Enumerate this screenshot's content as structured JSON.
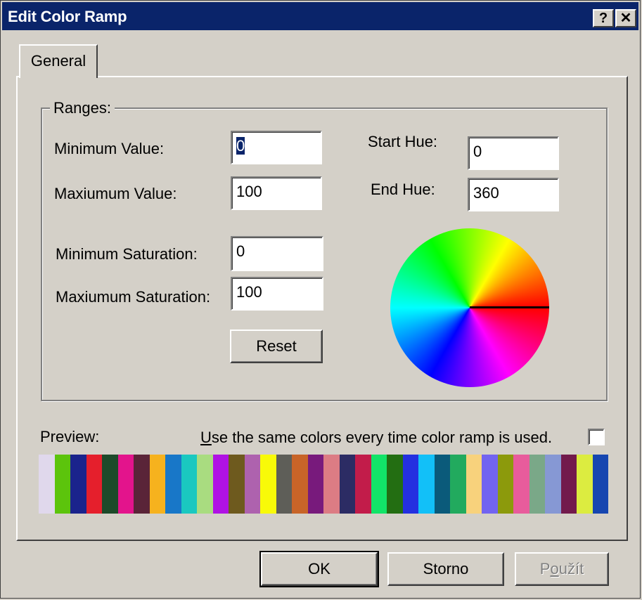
{
  "window": {
    "title": "Edit Color Ramp",
    "help_glyph": "?",
    "close_glyph": "✕"
  },
  "tabs": [
    {
      "label": "General",
      "selected": true
    }
  ],
  "ranges": {
    "legend": "Ranges:",
    "min_value_label": "Minimum Value:",
    "min_value": "0",
    "max_value_label": "Maxiumum Value:",
    "max_value": "100",
    "min_saturation_label": "Minimum Saturation:",
    "min_saturation": "0",
    "max_saturation_label": "Maxiumum Saturation:",
    "max_saturation": "100",
    "start_hue_label": "Start Hue:",
    "start_hue": "0",
    "end_hue_label": "End Hue:",
    "end_hue": "360",
    "reset_label": "Reset"
  },
  "preview": {
    "label": "Preview:",
    "same_colors_prefix": "U",
    "same_colors_rest": "se the same colors every time color ramp is used.",
    "same_colors_checked": false,
    "swatches": [
      "#e0d8ec",
      "#5cc40c",
      "#1a238c",
      "#e51f2c",
      "#1d4a2a",
      "#e3148c",
      "#5a2438",
      "#f6b21e",
      "#1877c8",
      "#1ac8c0",
      "#a9dc80",
      "#b012e4",
      "#6e5a1e",
      "#ae62ae",
      "#f8fa08",
      "#5e5e58",
      "#c86428",
      "#781a7c",
      "#dc7c84",
      "#2c2c64",
      "#c21c4a",
      "#12e468",
      "#236e12",
      "#2430e0",
      "#12c0f8",
      "#0a5a7a",
      "#22aa5e",
      "#f8d27c",
      "#7264f0",
      "#8c9a0c",
      "#e85c9c",
      "#7aa888",
      "#8698d4",
      "#721a4c",
      "#dcec40",
      "#1646b0"
    ]
  },
  "footer": {
    "ok_label": "OK",
    "cancel_label": "Storno",
    "apply_prefix": "P",
    "apply_mnemonic": "o",
    "apply_rest": "užít"
  },
  "colors": {
    "titlebar": "#0a246a",
    "face": "#d4d0c8"
  }
}
